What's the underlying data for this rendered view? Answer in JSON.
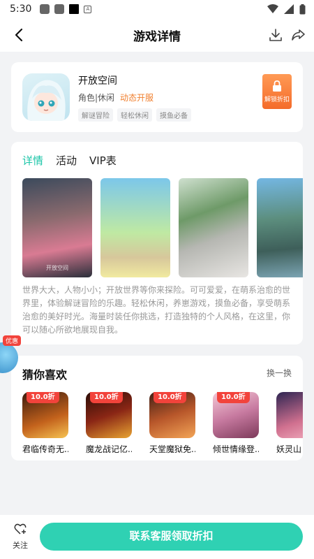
{
  "status_bar": {
    "time": "5:30",
    "notif_letter": "A"
  },
  "nav": {
    "title": "游戏详情"
  },
  "game": {
    "name": "开放空间",
    "category": "角色|休闲",
    "status": "动态开服",
    "tags": [
      "解谜冒险",
      "轻松休闲",
      "摸鱼必备"
    ],
    "unlock_label": "解锁折扣"
  },
  "details": {
    "tabs": [
      "详情",
      "活动",
      "VIP表"
    ],
    "active_tab": 0,
    "screenshot_caption": "开放空间",
    "description": "世界大大，人物小小；开放世界等你来探险。可可爱爱，在萌系治愈的世界里，体验解谜冒险的乐趣。轻松休闲，养崽游戏，摸鱼必备，享受萌系治愈的美好时光。海量时装任你挑选，打造独特的个人风格，在这里，你可以随心所欲地展现自我。"
  },
  "recommend": {
    "title": "猜你喜欢",
    "refresh_label": "换一换",
    "items": [
      {
        "discount": "10.0折",
        "name": "君临传奇无..."
      },
      {
        "discount": "10.0折",
        "name": "魔龙战记亿..."
      },
      {
        "discount": "10.0折",
        "name": "天堂魔狱免..."
      },
      {
        "discount": "10.0折",
        "name": "倾世情缘登..."
      },
      {
        "discount": "",
        "name": "妖灵山"
      }
    ]
  },
  "float_promo": {
    "label": "优惠"
  },
  "bottom": {
    "follow_label": "关注",
    "cta_label": "联系客服领取折扣"
  },
  "colors": {
    "accent": "#2fd1b3",
    "tab_active": "#1cc5a8",
    "status_orange": "#f08030",
    "discount_red": "#f2433b"
  }
}
